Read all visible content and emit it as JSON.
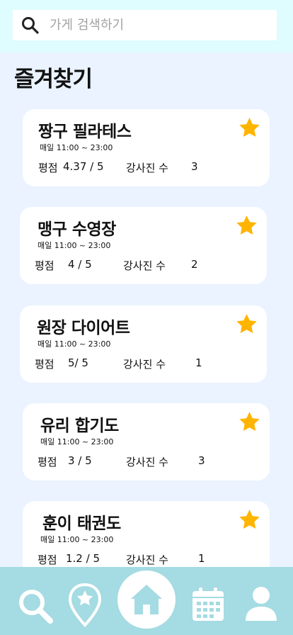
{
  "search": {
    "placeholder": "가게 검색하기"
  },
  "page_title": "즐겨찾기",
  "favorites": [
    {
      "name": "짱구 필라테스",
      "hours": "매일 11:00 ~ 23:00",
      "rating_label": "평점",
      "rating": "4.37 / 5",
      "instructor_label": "강사진 수",
      "instructors": "3"
    },
    {
      "name": "맹구 수영장",
      "hours": "매일 11:00 ~ 23:00",
      "rating_label": "평점",
      "rating": "4 / 5",
      "instructor_label": "강사진 수",
      "instructors": "2"
    },
    {
      "name": "원장 다이어트",
      "hours": "매일 11:00 ~ 23:00",
      "rating_label": "평점",
      "rating": "5/ 5",
      "instructor_label": "강사진 수",
      "instructors": "1"
    },
    {
      "name": "유리 합기도",
      "hours": "매일 11:00 ~ 23:00",
      "rating_label": "평점",
      "rating": "3 / 5",
      "instructor_label": "강사진 수",
      "instructors": "3"
    },
    {
      "name": "훈이 태권도",
      "hours": "매일 11:00 ~ 23:00",
      "rating_label": "평점",
      "rating": "1.2 / 5",
      "instructor_label": "강사진 수",
      "instructors": "1"
    }
  ],
  "icons": {
    "search": "search-icon",
    "favorite": "star-icon",
    "tab_search": "search-icon",
    "tab_favorites": "map-pin-star-icon",
    "tab_home": "home-icon",
    "tab_calendar": "calendar-icon",
    "tab_profile": "user-icon"
  },
  "colors": {
    "background": "#eaf3ff",
    "header": "#dffcff",
    "tabbar": "#a5dbe2",
    "star": "#ffb400",
    "tab_icon": "#ffffff"
  }
}
